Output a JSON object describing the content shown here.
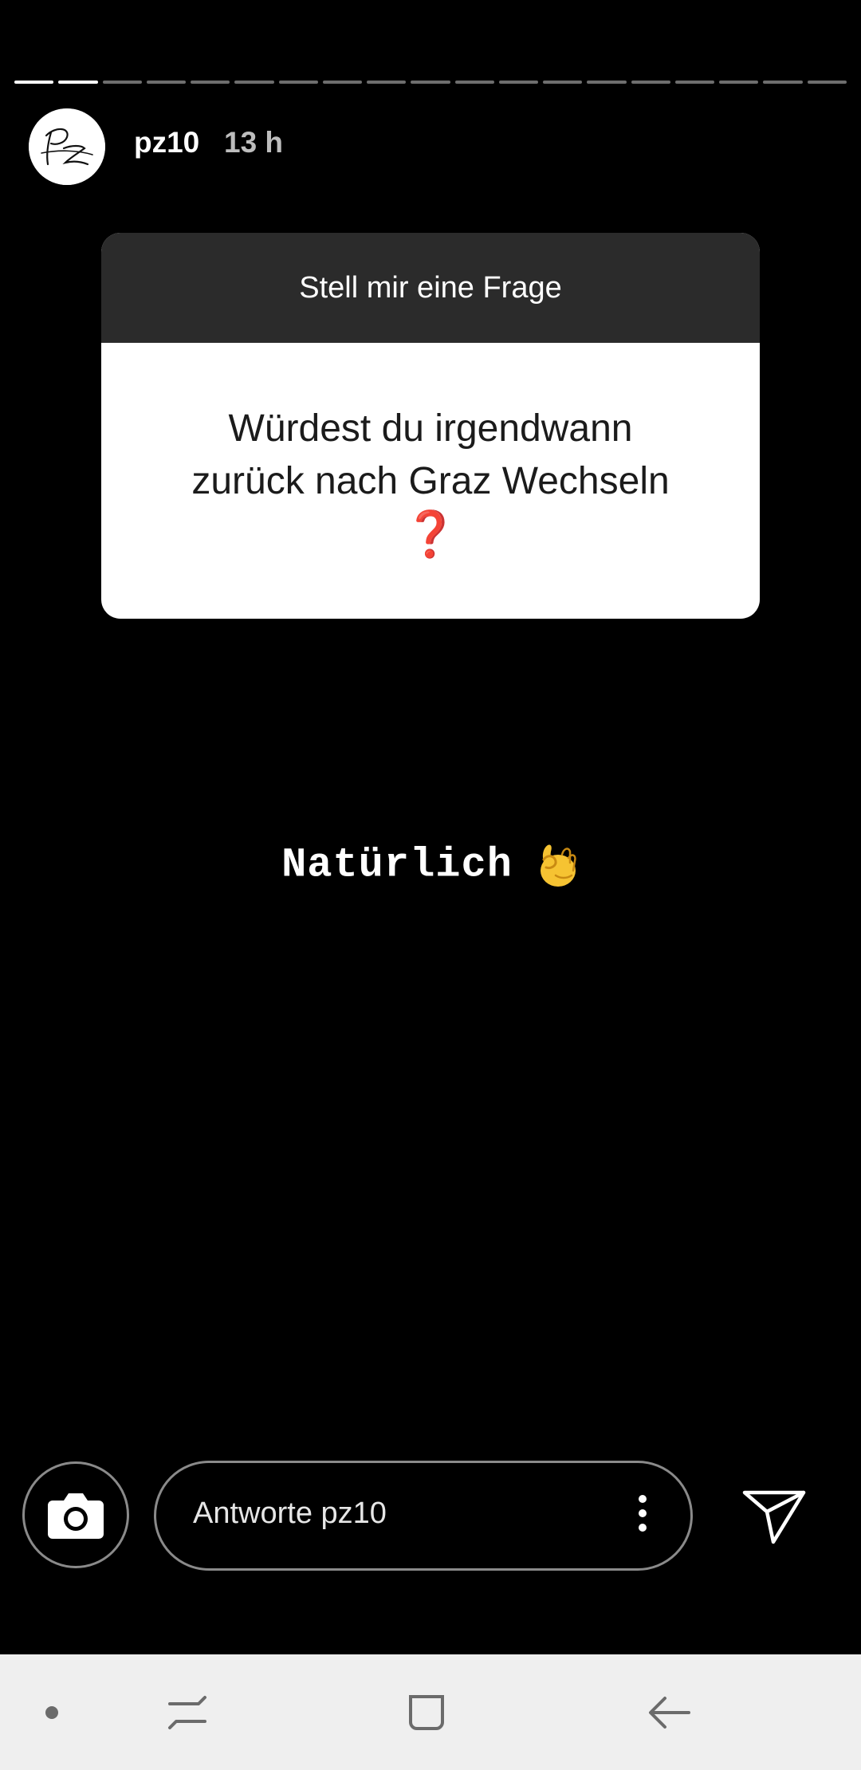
{
  "header": {
    "username": "pz10",
    "time_ago": "13 h",
    "avatar_icon": "pz-monogram-icon"
  },
  "progress": {
    "segments": 19,
    "current": 2
  },
  "question_card": {
    "title": "Stell mir eine Frage",
    "question_line1": "Würdest du irgendwann",
    "question_line2": "zurück nach Graz Wechseln",
    "question_mark": "❓"
  },
  "answer": {
    "text": "Natürlich",
    "emoji_icon": "ok-hand-icon"
  },
  "reply_bar": {
    "placeholder": "Antworte pz10",
    "camera_icon": "camera-icon",
    "more_icon": "more-vertical-icon",
    "send_icon": "send-icon"
  },
  "navbar": {
    "items": [
      "dot-icon",
      "recent-apps-icon",
      "home-icon",
      "back-icon"
    ]
  },
  "colors": {
    "background": "#000000",
    "card_header": "#2b2b2b",
    "question_mark": "#d0131b",
    "navbar": "#efefef"
  }
}
